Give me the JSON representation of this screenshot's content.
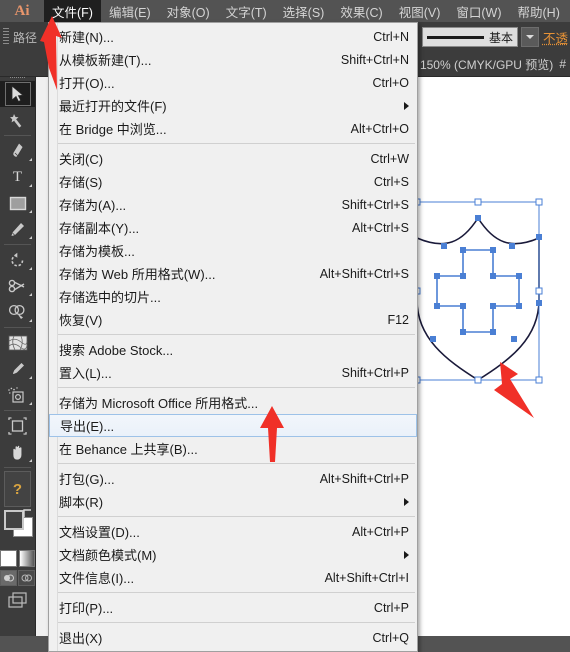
{
  "app": {
    "logo": "Ai",
    "menubar": [
      {
        "label": "文件(F)",
        "active": true
      },
      {
        "label": "编辑(E)",
        "active": false
      },
      {
        "label": "对象(O)",
        "active": false
      },
      {
        "label": "文字(T)",
        "active": false
      },
      {
        "label": "选择(S)",
        "active": false
      },
      {
        "label": "效果(C)",
        "active": false
      },
      {
        "label": "视图(V)",
        "active": false
      },
      {
        "label": "窗口(W)",
        "active": false
      },
      {
        "label": "帮助(H)",
        "active": false
      }
    ]
  },
  "controlbar": {
    "panel_label": "路径",
    "stroke_profile": "基本",
    "opacity_label": "不透"
  },
  "statusbar": {
    "zoom": "150% (CMYK/GPU 预览)",
    "extra": "#"
  },
  "toolpanel": {
    "tools": [
      {
        "name": "selection-tool",
        "selected": true
      },
      {
        "name": "magic-wand-tool",
        "selected": false
      },
      {
        "name": "pen-tool",
        "selected": false
      },
      {
        "name": "type-tool",
        "selected": false,
        "glyph": "T"
      },
      {
        "name": "rectangle-tool",
        "selected": false
      },
      {
        "name": "paintbrush-tool",
        "selected": false
      },
      {
        "name": "rotate-tool",
        "selected": false
      },
      {
        "name": "scale-tool",
        "selected": false
      },
      {
        "name": "shape-builder-tool",
        "selected": false
      },
      {
        "name": "mesh-tool",
        "selected": false
      },
      {
        "name": "eyedropper-tool",
        "selected": false
      },
      {
        "name": "symbol-sprayer-tool",
        "selected": false
      },
      {
        "name": "artboard-tool",
        "selected": false
      },
      {
        "name": "hand-tool",
        "selected": false
      }
    ],
    "help_glyph": "?"
  },
  "filemenu": {
    "items": [
      {
        "type": "item",
        "label": "新建(N)...",
        "accel": "Ctrl+N"
      },
      {
        "type": "item",
        "label": "从模板新建(T)...",
        "accel": "Shift+Ctrl+N"
      },
      {
        "type": "item",
        "label": "打开(O)...",
        "accel": "Ctrl+O"
      },
      {
        "type": "item",
        "label": "最近打开的文件(F)",
        "accel": "",
        "submenu": true
      },
      {
        "type": "item",
        "label": "在 Bridge 中浏览...",
        "accel": "Alt+Ctrl+O"
      },
      {
        "type": "sep"
      },
      {
        "type": "item",
        "label": "关闭(C)",
        "accel": "Ctrl+W"
      },
      {
        "type": "item",
        "label": "存储(S)",
        "accel": "Ctrl+S"
      },
      {
        "type": "item",
        "label": "存储为(A)...",
        "accel": "Shift+Ctrl+S"
      },
      {
        "type": "item",
        "label": "存储副本(Y)...",
        "accel": "Alt+Ctrl+S"
      },
      {
        "type": "item",
        "label": "存储为模板...",
        "accel": ""
      },
      {
        "type": "item",
        "label": "存储为 Web 所用格式(W)...",
        "accel": "Alt+Shift+Ctrl+S"
      },
      {
        "type": "item",
        "label": "存储选中的切片...",
        "accel": ""
      },
      {
        "type": "item",
        "label": "恢复(V)",
        "accel": "F12"
      },
      {
        "type": "sep"
      },
      {
        "type": "item",
        "label": "搜索 Adobe Stock...",
        "accel": ""
      },
      {
        "type": "item",
        "label": "置入(L)...",
        "accel": "Shift+Ctrl+P"
      },
      {
        "type": "sep"
      },
      {
        "type": "item",
        "label": "存储为 Microsoft Office 所用格式...",
        "accel": ""
      },
      {
        "type": "item",
        "label": "导出(E)...",
        "accel": "",
        "highlighted": true
      },
      {
        "type": "item",
        "label": "在 Behance 上共享(B)...",
        "accel": ""
      },
      {
        "type": "sep"
      },
      {
        "type": "item",
        "label": "打包(G)...",
        "accel": "Alt+Shift+Ctrl+P"
      },
      {
        "type": "item",
        "label": "脚本(R)",
        "accel": "",
        "submenu": true
      },
      {
        "type": "sep"
      },
      {
        "type": "item",
        "label": "文档设置(D)...",
        "accel": "Alt+Ctrl+P"
      },
      {
        "type": "item",
        "label": "文档颜色模式(M)",
        "accel": "",
        "submenu": true
      },
      {
        "type": "item",
        "label": "文件信息(I)...",
        "accel": "Alt+Shift+Ctrl+I"
      },
      {
        "type": "sep"
      },
      {
        "type": "item",
        "label": "打印(P)...",
        "accel": "Ctrl+P"
      },
      {
        "type": "sep"
      },
      {
        "type": "item",
        "label": "退出(X)",
        "accel": "Ctrl+Q"
      }
    ]
  },
  "artwork": {
    "name": "shield-with-cross",
    "selection_color": "#2a6ed4",
    "stroke_color": "#1a1a3a"
  },
  "annotations": {
    "arrows": [
      {
        "name": "arrow-pointing-file-menu",
        "color": "#f03028"
      },
      {
        "name": "arrow-pointing-export-item",
        "color": "#f03028"
      },
      {
        "name": "arrow-pointing-artwork",
        "color": "#f03028"
      }
    ]
  },
  "colors": {
    "chrome": "#3c3c3c",
    "menubar": "#535353",
    "menu_bg": "#f0f0f0",
    "accent_orange": "#e79236",
    "highlight_border": "#9dc2e8",
    "red": "#f03028"
  }
}
